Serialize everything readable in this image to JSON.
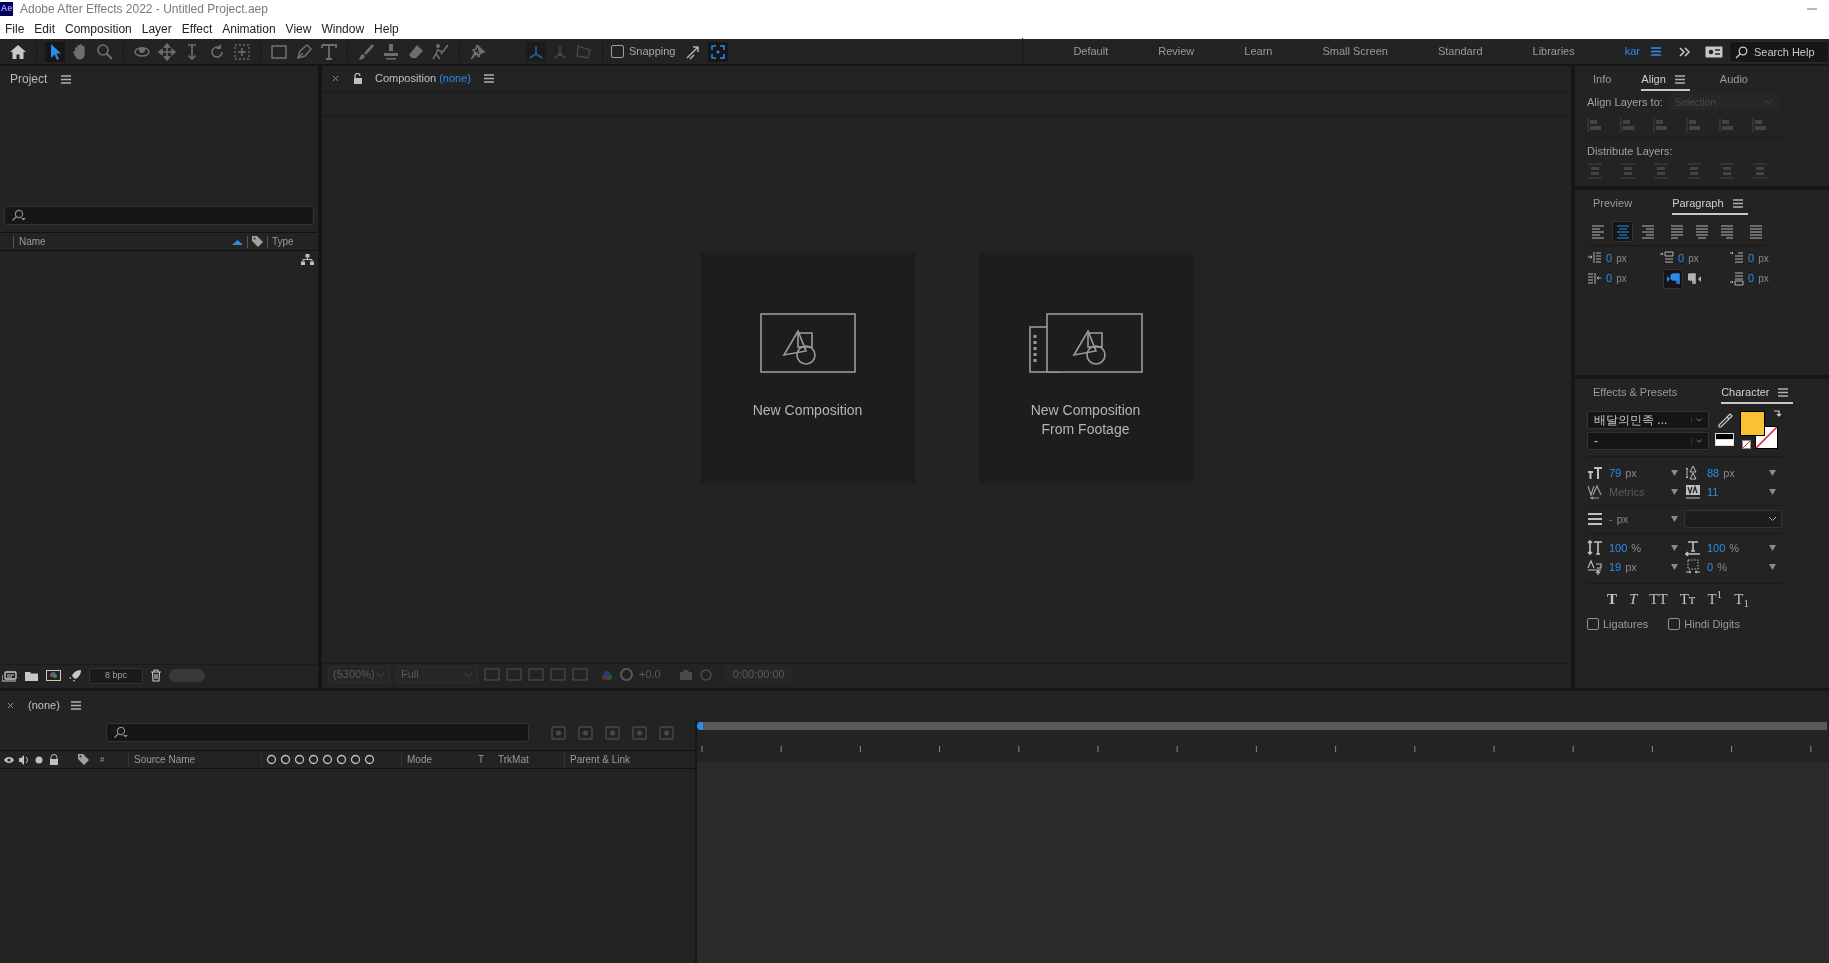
{
  "window": {
    "app_badge": "Ae",
    "title": "Adobe After Effects 2022 - Untitled Project.aep"
  },
  "menu": [
    "File",
    "Edit",
    "Composition",
    "Layer",
    "Effect",
    "Animation",
    "View",
    "Window",
    "Help"
  ],
  "toolbar": {
    "tools": [
      {
        "kind": "home",
        "selected": false
      },
      {
        "kind": "selection",
        "selected": true
      },
      {
        "kind": "hand",
        "selected": false
      },
      {
        "kind": "zoom",
        "selected": false
      },
      {
        "kind": "orbit",
        "selected": false
      },
      {
        "kind": "pan",
        "selected": false
      },
      {
        "kind": "dolly",
        "selected": false
      },
      {
        "kind": "rotate",
        "selected": false
      },
      {
        "kind": "anchor",
        "selected": false
      },
      {
        "kind": "rectangle",
        "selected": false
      },
      {
        "kind": "pen",
        "selected": false
      },
      {
        "kind": "type",
        "selected": false
      },
      {
        "kind": "brush",
        "selected": false
      },
      {
        "kind": "stamp",
        "selected": false
      },
      {
        "kind": "eraser",
        "selected": false
      },
      {
        "kind": "roto",
        "selected": false
      },
      {
        "kind": "pin",
        "selected": false
      }
    ],
    "axis_modes": [
      {
        "selected": true
      },
      {
        "selected": false
      },
      {
        "selected": false
      }
    ],
    "snapping": {
      "label": "Snapping",
      "checked": false
    },
    "snap_expand": {
      "selected": true
    }
  },
  "workspaces": [
    {
      "label": "Default",
      "selected": false
    },
    {
      "label": "Review",
      "selected": false
    },
    {
      "label": "Learn",
      "selected": false
    },
    {
      "label": "Small Screen",
      "selected": false
    },
    {
      "label": "Standard",
      "selected": false
    },
    {
      "label": "Libraries",
      "selected": false
    },
    {
      "label": "kar",
      "selected": true
    }
  ],
  "search_help": {
    "placeholder": "Search Help"
  },
  "project_panel": {
    "title": "Project",
    "columns": [
      "Name",
      "Type"
    ],
    "bit_depth": "8 bpc",
    "toggle": {
      "on": false
    }
  },
  "composition_panel": {
    "title": "Composition",
    "comp_name": "(none)",
    "cards": [
      {
        "kind": "new",
        "label": "New Composition"
      },
      {
        "kind": "footage",
        "label": "New Composition\nFrom Footage"
      }
    ],
    "magnification": "(5300%)",
    "resolution": "Full",
    "exposure": "+0.0",
    "timecode": "0:00:00:00"
  },
  "align_panel": {
    "tabs": [
      {
        "label": "Info",
        "selected": false
      },
      {
        "label": "Align",
        "selected": true
      },
      {
        "label": "Audio",
        "selected": false
      }
    ],
    "align_to_label": "Align Layers to:",
    "align_to": "Selection",
    "distribute_label": "Distribute Layers:"
  },
  "paragraph_panel": {
    "tabs": [
      {
        "label": "Preview",
        "selected": false
      },
      {
        "label": "Paragraph",
        "selected": true
      }
    ],
    "alignments": [
      {
        "selected": false
      },
      {
        "selected": true
      },
      {
        "selected": false
      },
      {
        "selected": false
      },
      {
        "selected": false
      },
      {
        "selected": false
      },
      {
        "selected": false
      }
    ],
    "fields": [
      {
        "value": "0",
        "unit": "px"
      },
      {
        "value": "0",
        "unit": "px"
      },
      {
        "value": "0",
        "unit": "px"
      },
      {
        "value": "0",
        "unit": "px"
      },
      {
        "value": "0",
        "unit": "px"
      }
    ],
    "directions": [
      {
        "selected": true
      },
      {
        "selected": false
      }
    ]
  },
  "character_panel": {
    "tabs": [
      {
        "label": "Effects & Presets",
        "selected": false
      },
      {
        "label": "Character",
        "selected": true
      }
    ],
    "font": "배달의민족 ...",
    "font_style": "-",
    "fill": {
      "color": "#f9c233"
    },
    "metrics": [
      {
        "kind": "size",
        "value": "79",
        "unit": "px",
        "disabled": false
      },
      {
        "kind": "leading",
        "value": "88",
        "unit": "px",
        "disabled": false
      },
      {
        "kind": "kerning",
        "value": "Metrics",
        "disabled": true
      },
      {
        "kind": "tracking",
        "value": "11",
        "disabled": false
      }
    ],
    "stroke": {
      "value": "-",
      "unit": "px"
    },
    "scales": [
      {
        "kind": "vscale",
        "value": "100",
        "unit": "%"
      },
      {
        "kind": "hscale",
        "value": "100",
        "unit": "%"
      },
      {
        "kind": "baseline",
        "value": "19",
        "unit": "px"
      },
      {
        "kind": "tsume",
        "value": "0",
        "unit": "%"
      }
    ],
    "styles": [
      {
        "kind": "bold",
        "text": "T"
      },
      {
        "kind": "italic",
        "text": "T"
      },
      {
        "kind": "plain",
        "text": "TT"
      },
      {
        "kind": "plain",
        "text": "Tᴛ"
      },
      {
        "kind": "plain",
        "text": "T$^{1}$"
      },
      {
        "kind": "plain",
        "text": "T$_{1}$"
      }
    ],
    "options": [
      {
        "label": "Ligatures",
        "checked": false
      },
      {
        "label": "Hindi Digits",
        "checked": false
      }
    ]
  },
  "timeline": {
    "title": "(none)",
    "columns": [
      "#",
      "Source Name",
      "Mode",
      "T",
      "TrkMat",
      "Parent & Link"
    ]
  }
}
